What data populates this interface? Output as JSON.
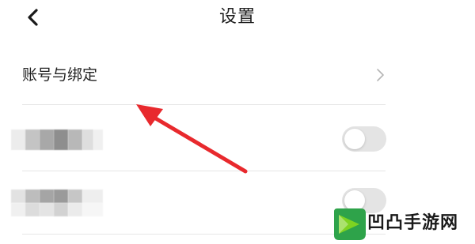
{
  "header": {
    "title": "设置",
    "back_icon": "chevron-left-icon"
  },
  "account_row": {
    "label": "账号与绑定",
    "chevron_icon": "chevron-right-icon"
  },
  "toggle_rows": [
    {
      "label_visible": false,
      "toggle_on": false
    },
    {
      "label_visible": false,
      "toggle_on": false
    }
  ],
  "annotation": {
    "arrow_color": "#e8292d"
  },
  "watermark": {
    "text": "凹凸手游网",
    "logo_colors": [
      "#2ea34a",
      "#7ed321"
    ]
  },
  "colors": {
    "divider": "#e6e6e6",
    "toggle_off": "#e4e4e4"
  }
}
